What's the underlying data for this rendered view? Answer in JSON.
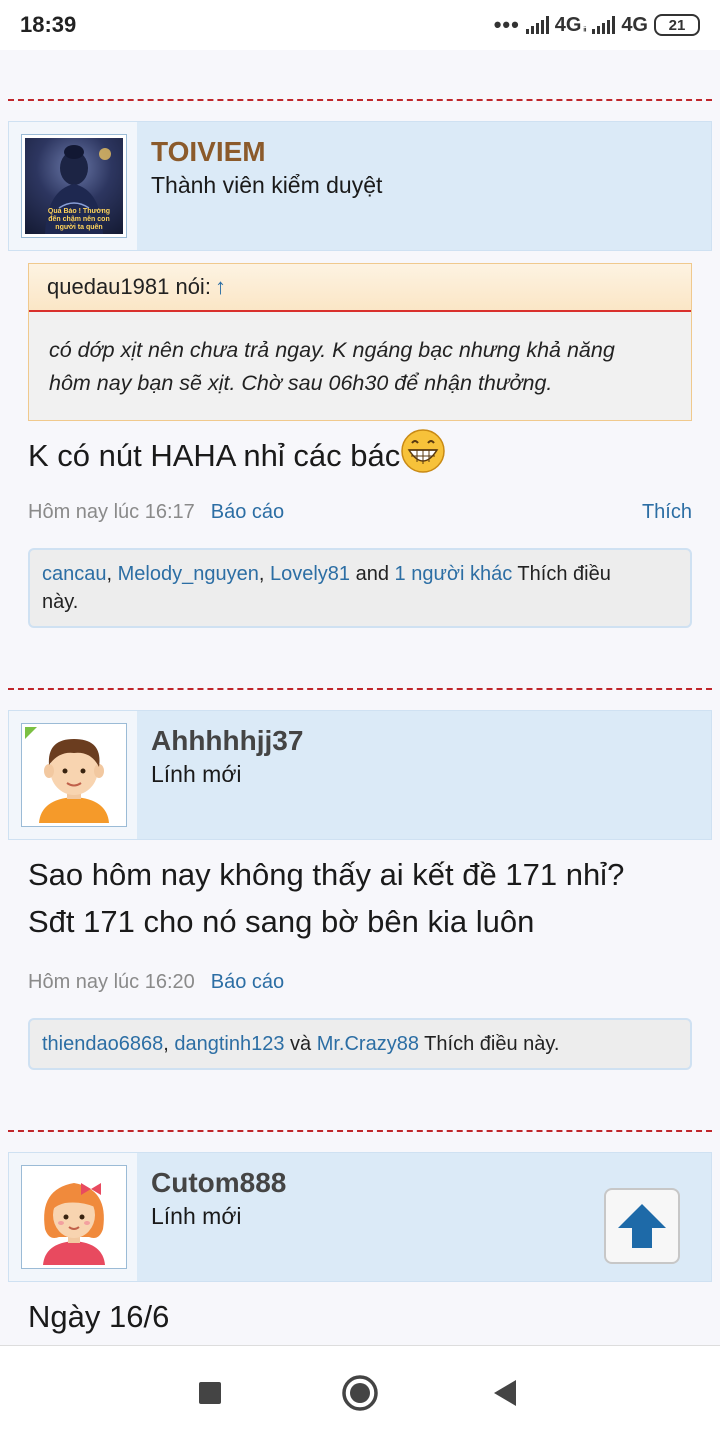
{
  "status_bar": {
    "time": "18:39",
    "dots": "•••",
    "network_1": "4G",
    "network_1_small": "ᵢᵢ",
    "network_2": "4G",
    "battery": "21"
  },
  "posts": [
    {
      "username": "TOIVIEM",
      "username_color": "#8b5a2b",
      "user_title": "Thành viên kiểm duyệt",
      "avatar_caption": "Quả Báo ! Thường đến chậm nên con người ta quên",
      "quote": {
        "author_line": "quedau1981 nói:",
        "arrow": "↑",
        "lines": [
          "có dớp xịt nên chưa trả ngay. K ngáng bạc nhưng khả năng",
          "hôm nay bạn sẽ xịt. Chờ sau 06h30 để nhận thưởng."
        ]
      },
      "text_lines": [
        "K có nút HAHA nhỉ các bác"
      ],
      "emoji": "grinning-face",
      "timestamp": "Hôm nay lúc 16:17",
      "report": "Báo cáo",
      "like": "Thích",
      "likers": [
        "cancau",
        "Melody_nguyen",
        "Lovely81"
      ],
      "likes_and": "and",
      "likes_others": "1 người khác",
      "likes_suffix": "Thích điều",
      "likes_suffix2": "này."
    },
    {
      "username": "Ahhhhhjj37",
      "username_color": "#444444",
      "user_title": "Lính mới",
      "text_lines": [
        "Sao hôm nay không thấy ai kết đề 171 nhỉ?",
        "Sđt 171 cho nó sang bờ bên kia luôn"
      ],
      "timestamp": "Hôm nay lúc 16:20",
      "report": "Báo cáo",
      "likers": [
        "thiendao6868",
        "dangtinh123"
      ],
      "likes_and": "và",
      "likes_last": "Mr.Crazy88",
      "likes_suffix": "Thích điều này."
    },
    {
      "username": "Cutom888",
      "username_color": "#444444",
      "user_title": "Lính mới",
      "text_lines": [
        "Ngày 16/6"
      ]
    }
  ],
  "colors": {
    "link": "#2c6ea4",
    "divider": "#c0262b",
    "header_bg": "#dbeaf7",
    "quote_border": "#f0c98d"
  },
  "icons": {
    "scroll_top": "arrow-up-icon",
    "nav": [
      "recent-apps-icon",
      "home-icon",
      "back-icon"
    ]
  }
}
